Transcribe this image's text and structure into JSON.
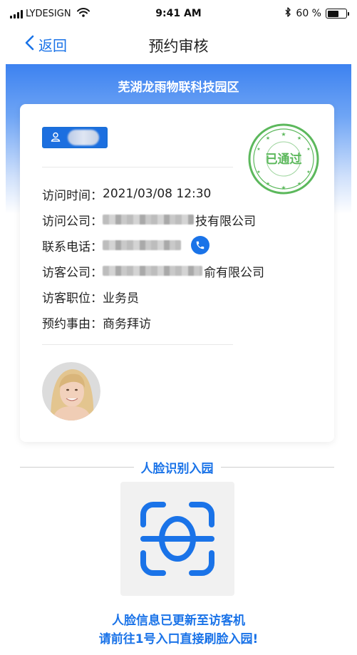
{
  "status_bar": {
    "carrier": "LYDESIGN",
    "time": "9:41 AM",
    "battery_text": "60 %",
    "battery_level": 0.6
  },
  "nav": {
    "back_label": "返回",
    "title": "预约审核"
  },
  "hero": {
    "park_name": "芜湖龙雨物联科技园区"
  },
  "card": {
    "stamp_text": "已通过",
    "stamp_color": "#5cb85c",
    "rows": [
      {
        "label": "访问时间：",
        "value": "2021/03/08 12:30"
      },
      {
        "label": "访问公司：",
        "value": "技有限公司"
      },
      {
        "label": "联系电话：",
        "value": ""
      },
      {
        "label": "访客公司：",
        "value": "俞有限公司"
      },
      {
        "label": "访客职位：",
        "value": "业务员"
      },
      {
        "label": "预约事由：",
        "value": "商务拜访"
      }
    ]
  },
  "face_recognition": {
    "header": "人脸识别入园",
    "message_line1": "人脸信息已更新至访客机",
    "message_line2": "请前往1号入口直接刷脸入园!"
  },
  "colors": {
    "accent": "#1a73e8",
    "approved_green": "#5cb85c"
  }
}
